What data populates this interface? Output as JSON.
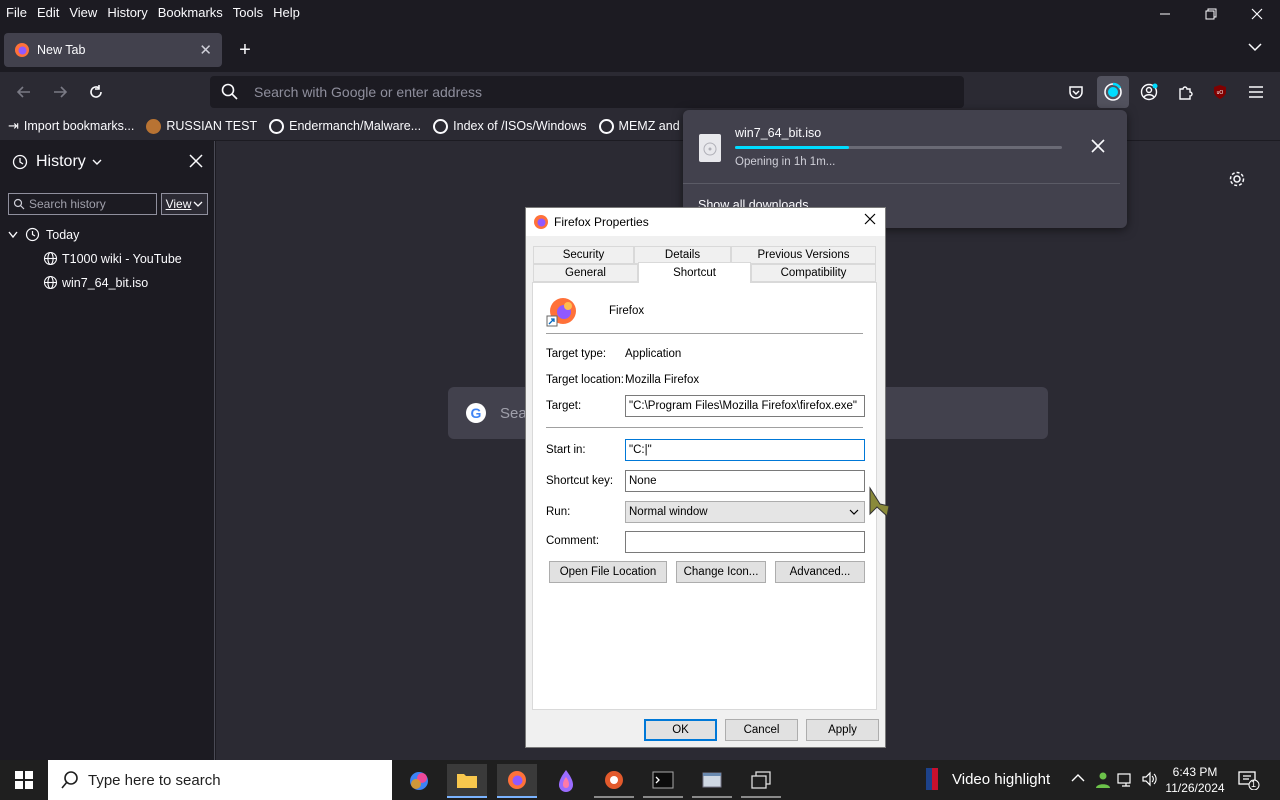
{
  "menu": [
    "File",
    "Edit",
    "View",
    "History",
    "Bookmarks",
    "Tools",
    "Help"
  ],
  "tab": {
    "title": "New Tab"
  },
  "urlbar": {
    "placeholder": "Search with Google or enter address"
  },
  "bookmarks": [
    "Import bookmarks...",
    "RUSSIAN TEST",
    "Endermanch/Malware...",
    "Index of /ISOs/Windows",
    "MEMZ and Noe"
  ],
  "sidebar": {
    "title": "History",
    "search_placeholder": "Search history",
    "view_label": "View",
    "group": "Today",
    "items": [
      "T1000 wiki - YouTube",
      "win7_64_bit.iso"
    ]
  },
  "content": {
    "search_placeholder": "Sea"
  },
  "download": {
    "filename": "win7_64_bit.iso",
    "status": "Opening in 1h 1m...",
    "progress": 0.35,
    "show_all": "Show all downloads"
  },
  "dialog": {
    "title": "Firefox Properties",
    "tabs_row1": [
      "Security",
      "Details",
      "Previous Versions"
    ],
    "tabs_row2": [
      "General",
      "Shortcut",
      "Compatibility"
    ],
    "app_name": "Firefox",
    "target_type_label": "Target type:",
    "target_type": "Application",
    "target_location_label": "Target location:",
    "target_location": "Mozilla Firefox",
    "target_label": "Target:",
    "target": "\"C:\\Program Files\\Mozilla Firefox\\firefox.exe\"",
    "start_in_label": "Start in:",
    "start_in": "\"C:|\"",
    "shortcut_key_label": "Shortcut key:",
    "shortcut_key": "None",
    "run_label": "Run:",
    "run": "Normal window",
    "comment_label": "Comment:",
    "comment": "",
    "btn_open_location": "Open File Location",
    "btn_change_icon": "Change Icon...",
    "btn_advanced": "Advanced...",
    "btn_ok": "OK",
    "btn_cancel": "Cancel",
    "btn_apply": "Apply"
  },
  "taskbar": {
    "search_placeholder": "Type here to search",
    "video_highlight": "Video highlight",
    "time": "6:43 PM",
    "date": "11/26/2024",
    "notifications": "1"
  },
  "colors": {
    "accent": "#00ddff",
    "toolbar": "#2b2a33",
    "frame": "#1c1b22",
    "dialog": "#f0f0f0",
    "focus": "#0078d7"
  }
}
